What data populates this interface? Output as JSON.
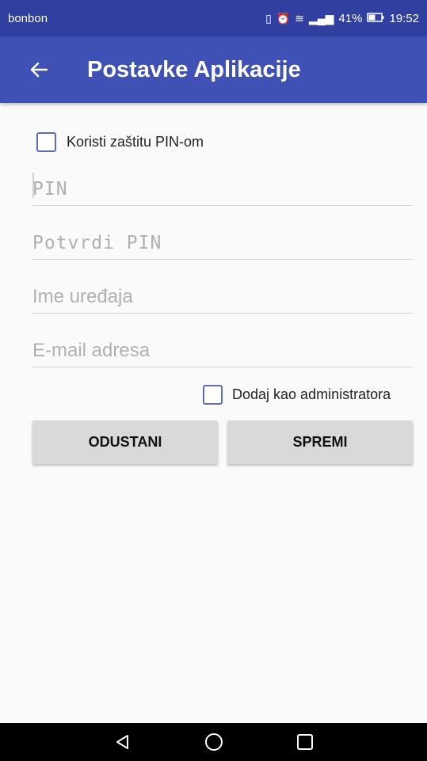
{
  "status_bar": {
    "carrier": "bonbon",
    "battery": "41%",
    "time": "19:52"
  },
  "app_bar": {
    "title": "Postavke Aplikacije"
  },
  "form": {
    "pin_protection_label": "Koristi zaštitu PIN-om",
    "pin_placeholder": "PIN",
    "confirm_pin_placeholder": "Potvrdi PIN",
    "device_name_placeholder": "Ime uređaja",
    "email_placeholder": "E-mail adresa",
    "admin_label": "Dodaj kao administratora"
  },
  "buttons": {
    "cancel": "ODUSTANI",
    "save": "SPREMI"
  },
  "colors": {
    "status_bar": "#303fa0",
    "app_bar": "#3f51b5",
    "checkbox_border": "#5a6bc0",
    "button": "#d9d9d9"
  }
}
